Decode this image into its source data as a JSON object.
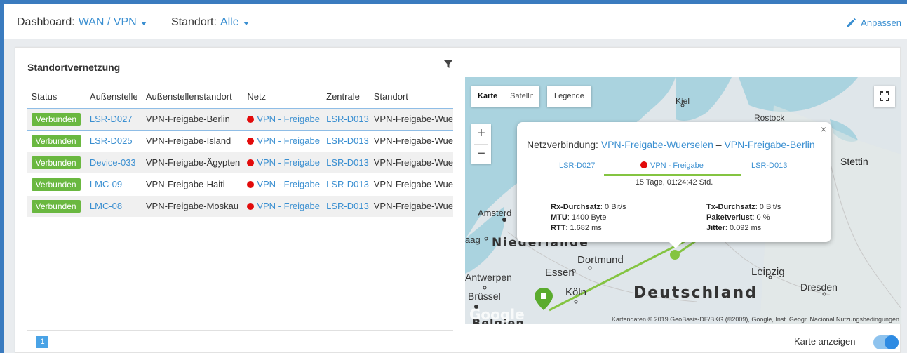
{
  "header": {
    "dashboard_label": "Dashboard:",
    "dashboard_value": "WAN / VPN",
    "site_label": "Standort:",
    "site_value": "Alle",
    "adjust_label": "Anpassen"
  },
  "card": {
    "title": "Standortvernetzung"
  },
  "table": {
    "columns": [
      "Status",
      "Außenstelle",
      "Außenstellenstandort",
      "Netz",
      "Zentrale",
      "Standort"
    ],
    "rows": [
      {
        "status": "Verbunden",
        "branch": "LSR-D027",
        "branch_site": "VPN-Freigabe-Berlin",
        "net": "VPN - Freigabe",
        "center": "LSR-D013",
        "site": "VPN-Freigabe-Wue"
      },
      {
        "status": "Verbunden",
        "branch": "LSR-D025",
        "branch_site": "VPN-Freigabe-Island",
        "net": "VPN - Freigabe",
        "center": "LSR-D013",
        "site": "VPN-Freigabe-Wue"
      },
      {
        "status": "Verbunden",
        "branch": "Device-033",
        "branch_site": "VPN-Freigabe-Ägypten",
        "net": "VPN - Freigabe",
        "center": "LSR-D013",
        "site": "VPN-Freigabe-Wue"
      },
      {
        "status": "Verbunden",
        "branch": "LMC-09",
        "branch_site": "VPN-Freigabe-Haiti",
        "net": "VPN - Freigabe",
        "center": "LSR-D013",
        "site": "VPN-Freigabe-Wue"
      },
      {
        "status": "Verbunden",
        "branch": "LMC-08",
        "branch_site": "VPN-Freigabe-Moskau",
        "net": "VPN - Freigabe",
        "center": "LSR-D013",
        "site": "VPN-Freigabe-Wue"
      }
    ]
  },
  "pagination": {
    "current": "1"
  },
  "map": {
    "type_map": "Karte",
    "type_satellite": "Satellit",
    "legend": "Legende",
    "zoom_in": "+",
    "zoom_out": "−",
    "credit": "Kartendaten © 2019 GeoBasis-DE/BKG (©2009), Google, Inst. Geogr. Nacional   Nutzungsbedingungen",
    "logo": "Google",
    "labels": {
      "kiel": "Kiel",
      "rostock": "Rostock",
      "stettin": "Stettin",
      "amsterdam": "Amsterd",
      "haag": "aag",
      "niederlande": "Niederlande",
      "dortmund": "Dortmund",
      "essen": "Essen",
      "antwerpen": "Antwerpen",
      "leipzig": "Leipzig",
      "koeln": "Köln",
      "bruessel": "Brüssel",
      "deutschland": "Deutschland",
      "dresden": "Dresden",
      "belgien": "Belgien"
    },
    "popup": {
      "title_prefix": "Netzverbindung:",
      "from": "VPN-Freigabe-Wuerselen",
      "separator": "–",
      "to": "VPN-Freigabe-Berlin",
      "left_device": "LSR-D027",
      "net": "VPN - Freigabe",
      "right_device": "LSR-D013",
      "uptime": "15 Tage, 01:24:42 Std.",
      "close": "×",
      "rx_label": "Rx-Durchsatz",
      "rx_value": ": 0 Bit/s",
      "mtu_label": "MTU",
      "mtu_value": ": 1400 Byte",
      "rtt_label": "RTT",
      "rtt_value": ": 1.682 ms",
      "tx_label": "Tx-Durchsatz",
      "tx_value": ": 0 Bit/s",
      "loss_label": "Paketverlust",
      "loss_value": ": 0 %",
      "jitter_label": "Jitter",
      "jitter_value": ": 0.092 ms"
    }
  },
  "footer": {
    "map_toggle_label": "Karte anzeigen"
  },
  "colors": {
    "accent": "#3a8fd1",
    "status_ok": "#6ab840",
    "link_line": "#84c441",
    "net_dot": "#e20b0b"
  }
}
